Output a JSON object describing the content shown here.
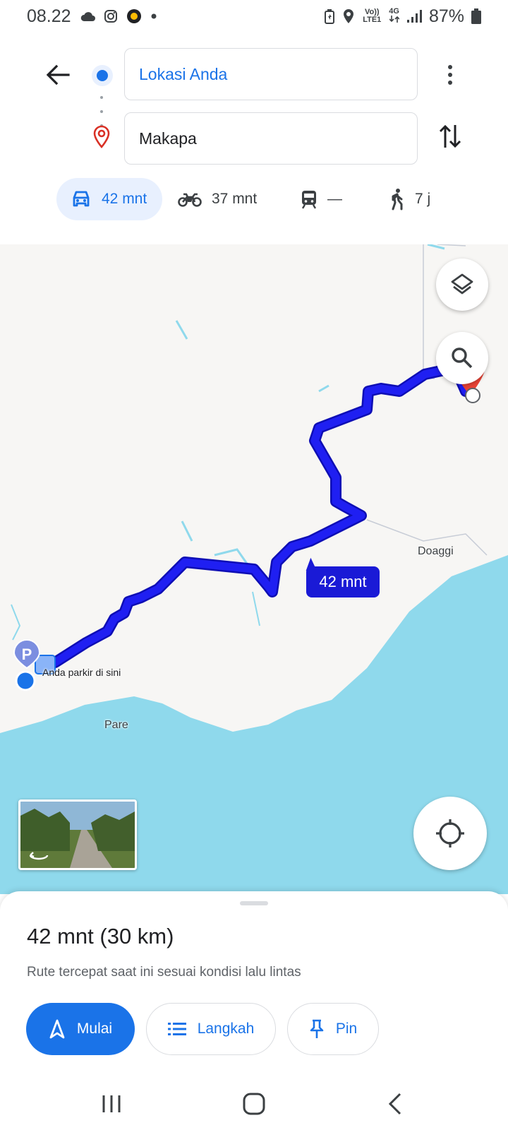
{
  "status_bar": {
    "time": "08.22",
    "network": "Vo)) LTE1",
    "net_type": "4G",
    "battery": "87%",
    "icons": [
      "cloud-icon",
      "instagram-icon",
      "app-notification-icon",
      "dot-icon",
      "battery-saver-icon",
      "location-icon",
      "volte-icon",
      "data-arrows-icon",
      "signal-icon",
      "battery-icon"
    ]
  },
  "search": {
    "origin": "Lokasi Anda",
    "destination": "Makapa"
  },
  "travel_modes": [
    {
      "mode": "car",
      "icon": "car-icon",
      "label": "42 mnt",
      "selected": true
    },
    {
      "mode": "motorcycle",
      "icon": "motorcycle-icon",
      "label": "37 mnt",
      "selected": false
    },
    {
      "mode": "transit",
      "icon": "train-icon",
      "label": "—",
      "selected": false
    },
    {
      "mode": "walk",
      "icon": "walk-icon",
      "label": "7 j",
      "selected": false
    }
  ],
  "map": {
    "route_duration": "42 mnt",
    "labels": {
      "doaggi": "Doaggi",
      "pare": "Pare",
      "parking": "Anda parkir di sini"
    },
    "parking_letter": "P"
  },
  "sheet": {
    "title": "42 mnt (30 km)",
    "subtitle": "Rute tercepat saat ini sesuai kondisi lalu lintas",
    "start_label": "Mulai",
    "steps_label": "Langkah",
    "pin_label": "Pin"
  },
  "colors": {
    "accent": "#1a73e8",
    "route": "#1a1ad6",
    "water": "#8fd9ec",
    "land": "#f7f6f4",
    "destination_pin": "#ea4335"
  }
}
